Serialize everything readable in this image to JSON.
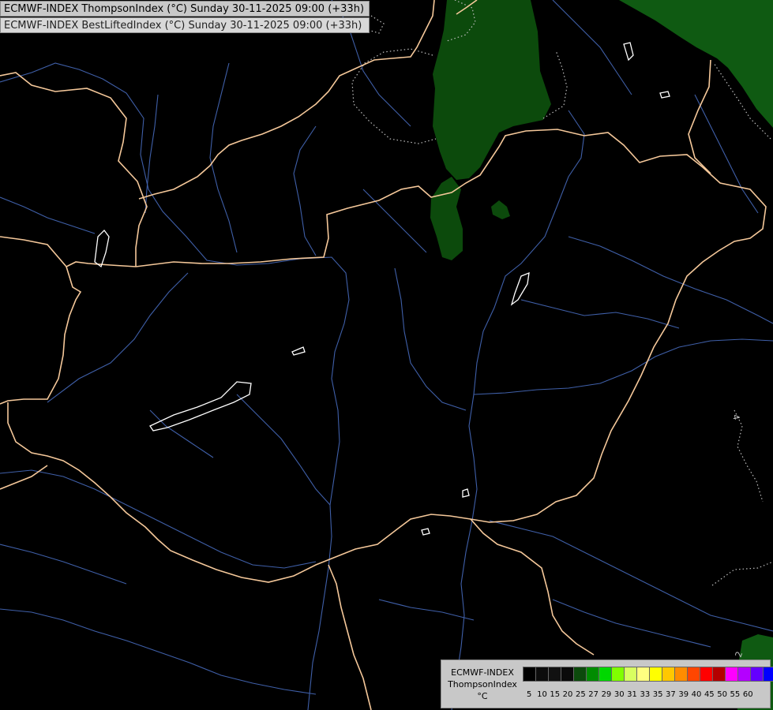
{
  "header": {
    "title_line1": "ECMWF-INDEX ThompsonIndex (°C) Sunday 30-11-2025 09:00 (+33h)",
    "title_line2": "ECMWF-INDEX BestLiftedIndex (°C) Sunday 30-11-2025 09:00 (+33h)"
  },
  "legend": {
    "line1": "ECMWF-INDEX",
    "line2": "ThompsonIndex",
    "line3": "°C",
    "ticks": [
      "5",
      "10",
      "15",
      "20",
      "25",
      "27",
      "29",
      "30",
      "31",
      "33",
      "35",
      "37",
      "39",
      "40",
      "45",
      "50",
      "55",
      "60"
    ],
    "colors": [
      "#000000",
      "#0c0c0c",
      "#111111",
      "#0a0a0a",
      "#0c4a0c",
      "#008c00",
      "#00d800",
      "#80ff00",
      "#d8ff60",
      "#ffff80",
      "#ffff00",
      "#ffc800",
      "#ff8c00",
      "#ff4600",
      "#ff0000",
      "#b40000",
      "#ff00ff",
      "#b400ff",
      "#6400ff",
      "#0000ff"
    ]
  },
  "contour_labels": [
    "4",
    "2"
  ],
  "map": {
    "background": "#000000",
    "border_color": "#f5c89a",
    "river_color": "#3f5fa8",
    "lake_color": "#ffffff",
    "contour_color": "#bdbdbd",
    "field_colors": [
      "#0c4a0c",
      "#0f5a12"
    ]
  }
}
